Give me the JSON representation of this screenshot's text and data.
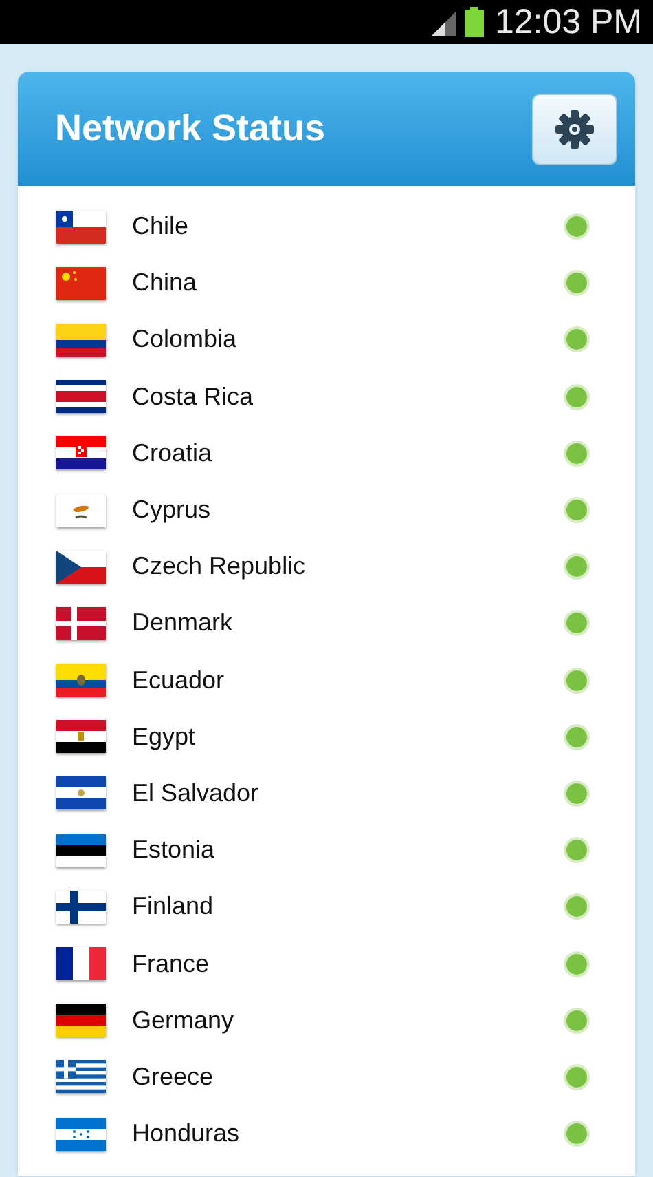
{
  "status_bar": {
    "time": "12:03 PM"
  },
  "header": {
    "title": "Network Status"
  },
  "countries": [
    {
      "name": "Chile",
      "color": "#7cc242"
    },
    {
      "name": "China",
      "color": "#7cc242"
    },
    {
      "name": "Colombia",
      "color": "#7cc242"
    },
    {
      "name": "Costa Rica",
      "color": "#7cc242"
    },
    {
      "name": "Croatia",
      "color": "#7cc242"
    },
    {
      "name": "Cyprus",
      "color": "#7cc242"
    },
    {
      "name": "Czech Republic",
      "color": "#7cc242"
    },
    {
      "name": "Denmark",
      "color": "#7cc242"
    },
    {
      "name": "Ecuador",
      "color": "#7cc242"
    },
    {
      "name": "Egypt",
      "color": "#7cc242"
    },
    {
      "name": "El Salvador",
      "color": "#7cc242"
    },
    {
      "name": "Estonia",
      "color": "#7cc242"
    },
    {
      "name": "Finland",
      "color": "#7cc242"
    },
    {
      "name": "France",
      "color": "#7cc242"
    },
    {
      "name": "Germany",
      "color": "#7cc242"
    },
    {
      "name": "Greece",
      "color": "#7cc242"
    },
    {
      "name": "Honduras",
      "color": "#7cc242"
    }
  ]
}
